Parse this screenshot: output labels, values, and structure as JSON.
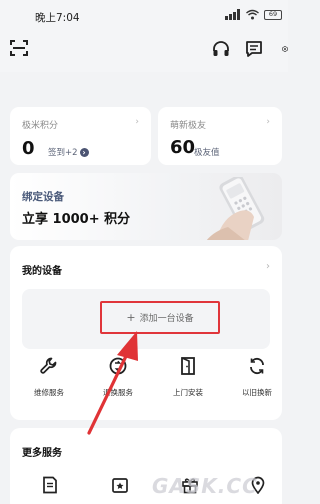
{
  "status_bar": {
    "time": "晚上7:04",
    "battery": "69"
  },
  "points": {
    "label": "极米积分",
    "value": "0",
    "checkin": "签到+2"
  },
  "friends": {
    "label": "萌新极友",
    "value": "60",
    "sub": "极友值"
  },
  "bind_banner": {
    "title": "绑定设备",
    "subtitle": "立享 1000+ 积分"
  },
  "my_devices": {
    "title": "我的设备",
    "add_label": "添加一台设备",
    "services": [
      {
        "icon": "wrench-icon",
        "label": "维修服务"
      },
      {
        "icon": "return-icon",
        "label": "退换服务"
      },
      {
        "icon": "door-icon",
        "label": "上门安装"
      },
      {
        "icon": "refresh-icon",
        "label": "以旧换新"
      }
    ]
  },
  "more_services": {
    "title": "更多服务"
  },
  "watermark": "GASK.CC",
  "colors": {
    "highlight": "#e0353a",
    "background": "#f2f3f5",
    "card": "#ffffff"
  }
}
